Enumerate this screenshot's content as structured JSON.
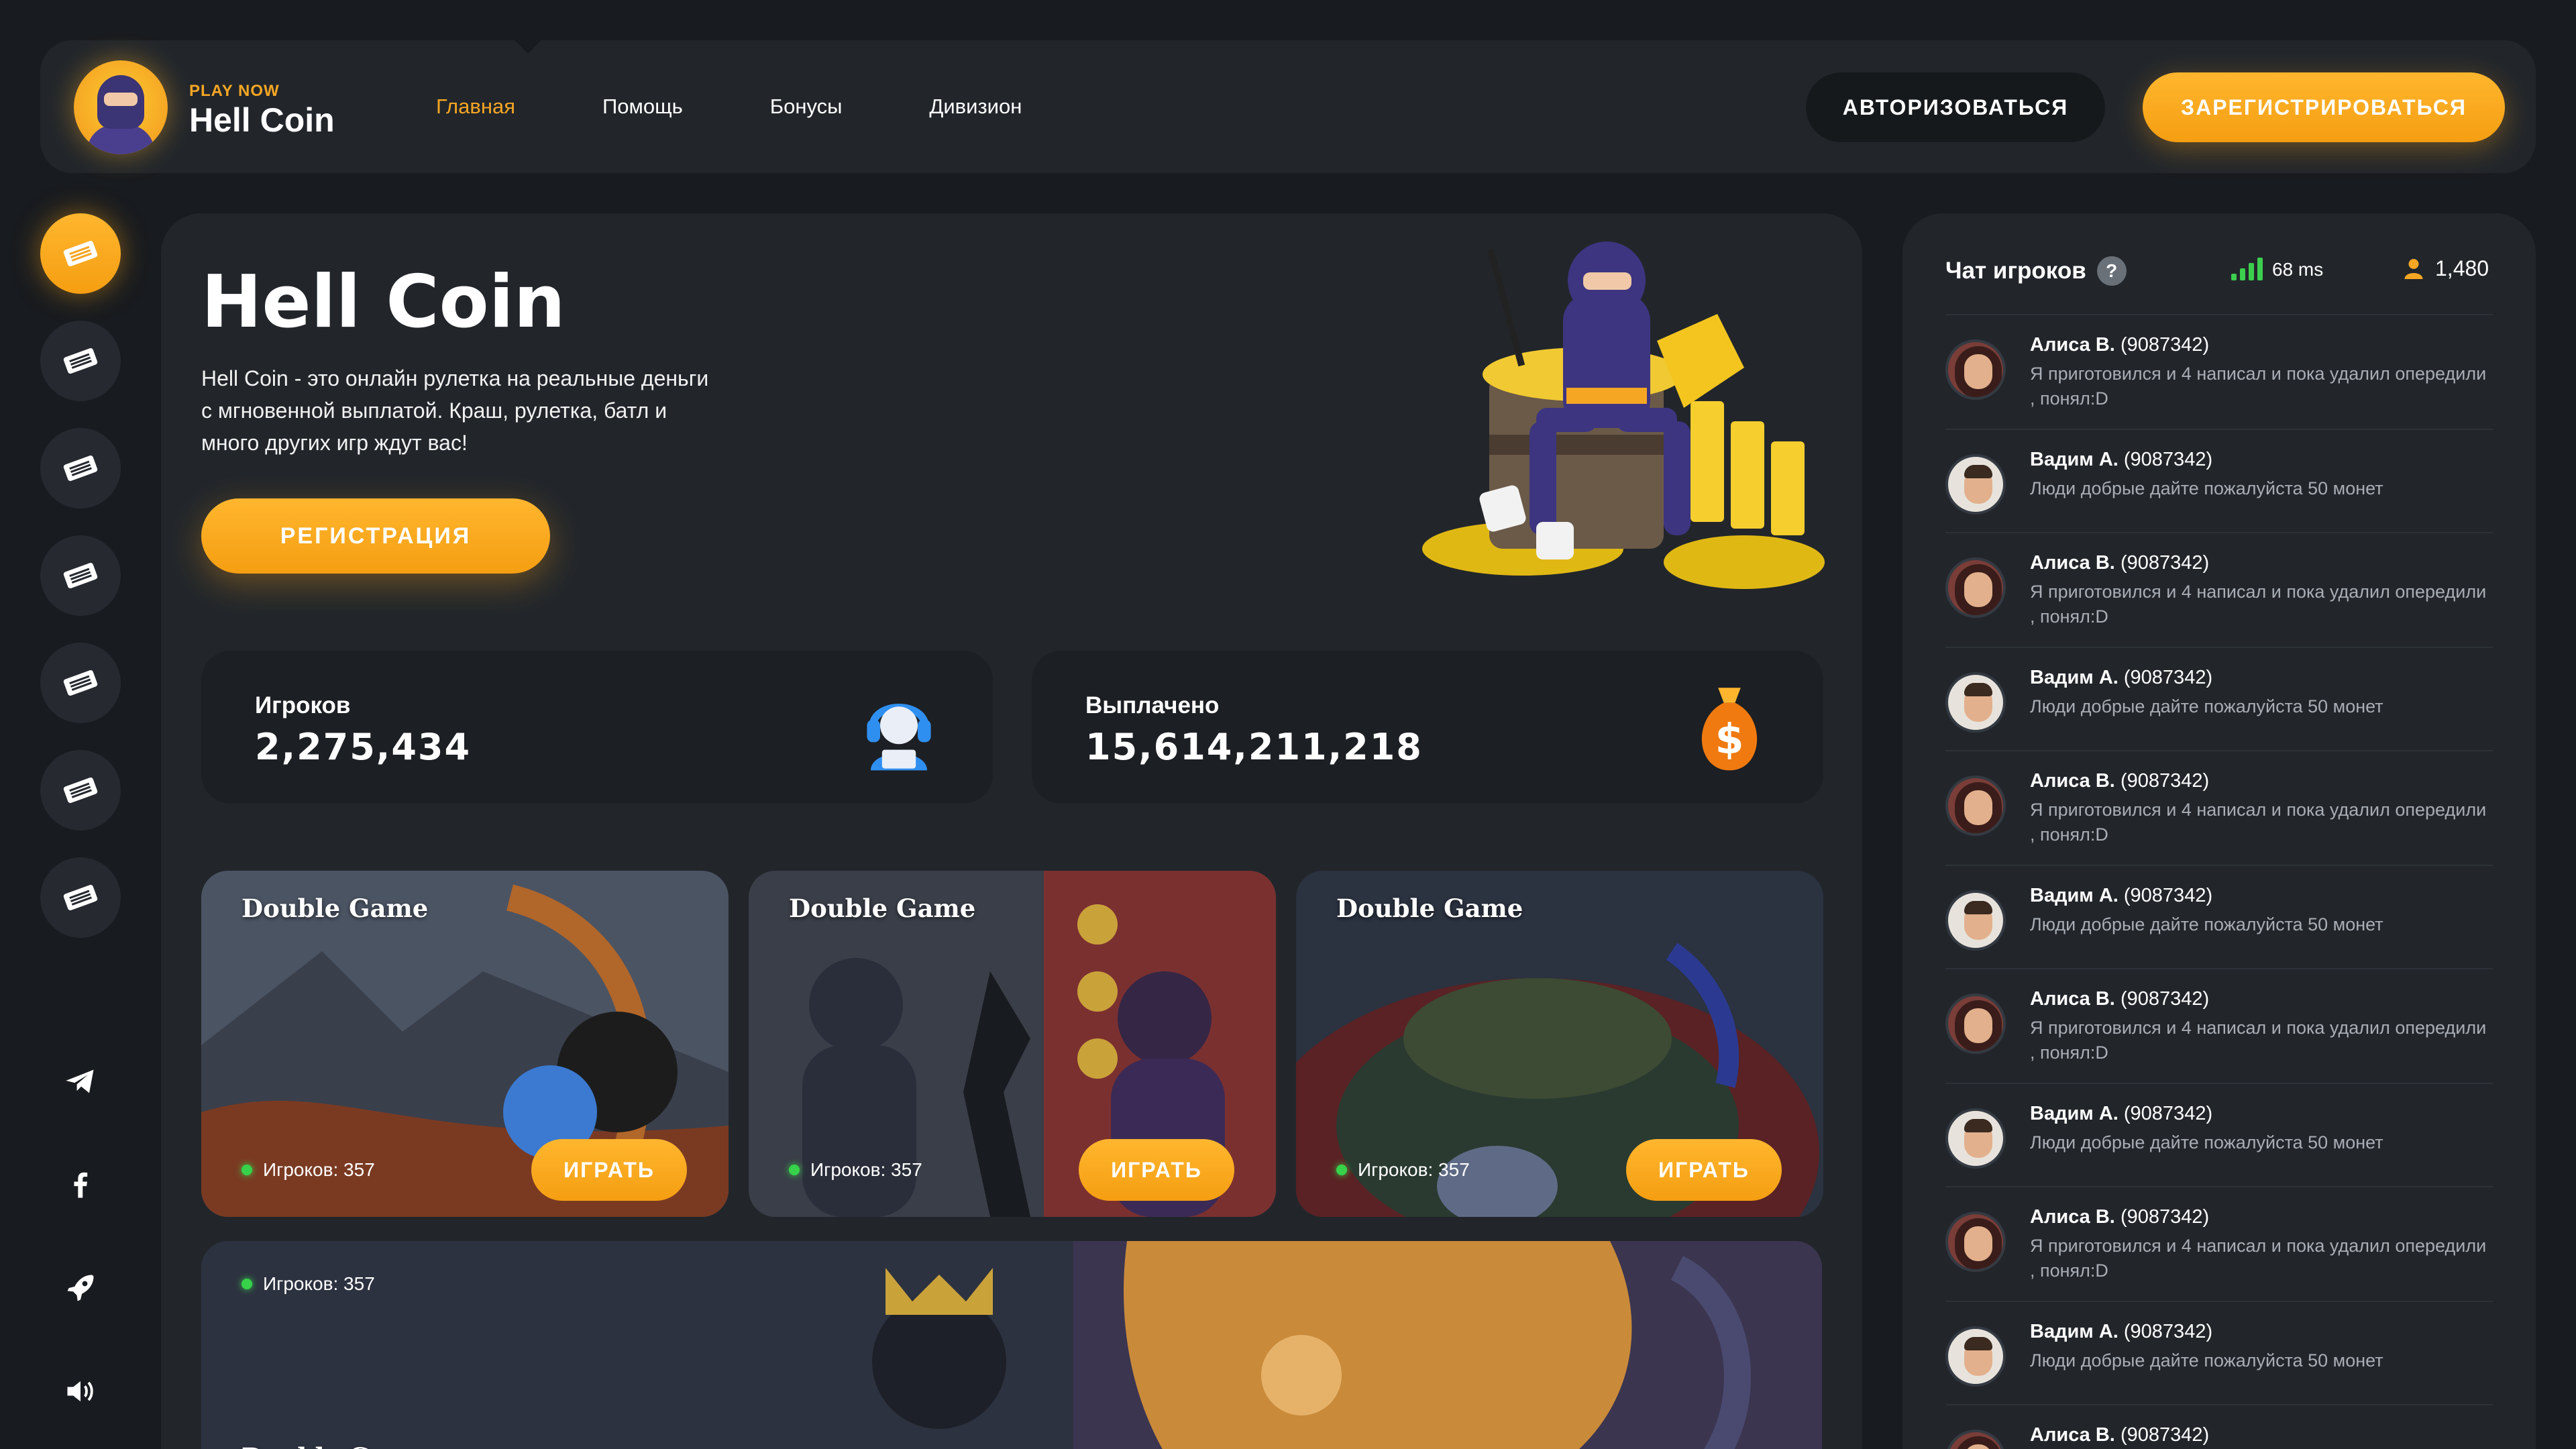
{
  "header": {
    "logo_tag": "PLAY NOW",
    "logo_name": "Hell Coin",
    "nav": [
      {
        "label": "Главная",
        "active": true
      },
      {
        "label": "Помощь",
        "active": false
      },
      {
        "label": "Бонусы",
        "active": false
      },
      {
        "label": "Дивизион",
        "active": false
      }
    ],
    "login_label": "АВТОРИЗОВАТЬСЯ",
    "register_label": "ЗАРЕГИСТРИРОВАТЬСЯ"
  },
  "sidebar": {
    "game_icons": [
      "ticket-icon",
      "ticket-icon",
      "ticket-icon",
      "ticket-icon",
      "ticket-icon",
      "ticket-icon",
      "ticket-icon"
    ],
    "social_icons": [
      "telegram-icon",
      "facebook-icon",
      "rocket-icon",
      "volume-icon"
    ]
  },
  "hero": {
    "title": "Hell Coin",
    "description": "Hell Coin - это онлайн рулетка на реальные деньги с мгновенной выплатой. Краш, рулетка, батл и много других игр ждут вас!",
    "button_label": "РЕГИСТРАЦИЯ"
  },
  "stats": {
    "players_label": "Игроков",
    "players_value": "2,275,434",
    "paid_label": "Выплачено",
    "paid_value": "15,614,211,218"
  },
  "games": [
    {
      "title": "Double Game",
      "players": "Игроков: 357",
      "button": "ИГРАТЬ"
    },
    {
      "title": "Double Game",
      "players": "Игроков: 357",
      "button": "ИГРАТЬ"
    },
    {
      "title": "Double Game",
      "players": "Игроков: 357",
      "button": "ИГРАТЬ"
    }
  ],
  "featured_game": {
    "title": "Double Game",
    "players": "Игроков: 357"
  },
  "chat": {
    "title": "Чат игроков",
    "help": "?",
    "ping": "68 ms",
    "online": "1,480",
    "messages": [
      {
        "name": "Алиса В.",
        "id": "(9087342)",
        "text": "Я приготовился и 4 написал и пока удалил опередили , понял:D",
        "avatar": "female"
      },
      {
        "name": "Вадим А.",
        "id": "(9087342)",
        "text": "Люди добрые дайте пожалуйста 50 монет",
        "avatar": "male"
      },
      {
        "name": "Алиса В.",
        "id": "(9087342)",
        "text": "Я приготовился и 4 написал и пока удалил опередили , понял:D",
        "avatar": "female"
      },
      {
        "name": "Вадим А.",
        "id": "(9087342)",
        "text": "Люди добрые дайте пожалуйста 50 монет",
        "avatar": "male"
      },
      {
        "name": "Алиса В.",
        "id": "(9087342)",
        "text": "Я приготовился и 4 написал и пока удалил опередили , понял:D",
        "avatar": "female"
      },
      {
        "name": "Вадим А.",
        "id": "(9087342)",
        "text": "Люди добрые дайте пожалуйста 50 монет",
        "avatar": "male"
      },
      {
        "name": "Алиса В.",
        "id": "(9087342)",
        "text": "Я приготовился и 4 написал и пока удалил опередили , понял:D",
        "avatar": "female"
      },
      {
        "name": "Вадим А.",
        "id": "(9087342)",
        "text": "Люди добрые дайте пожалуйста 50 монет",
        "avatar": "male"
      },
      {
        "name": "Алиса В.",
        "id": "(9087342)",
        "text": "Я приготовился и 4 написал и пока удалил опередили , понял:D",
        "avatar": "female"
      },
      {
        "name": "Вадим А.",
        "id": "(9087342)",
        "text": "Люди добрые дайте пожалуйста 50 монет",
        "avatar": "male"
      },
      {
        "name": "Алиса В.",
        "id": "(9087342)",
        "text": "",
        "avatar": "female"
      }
    ]
  },
  "colors": {
    "accent": "#f5a623",
    "background": "#181b1f",
    "panel": "#22262b",
    "online_dot": "#37d24a"
  }
}
